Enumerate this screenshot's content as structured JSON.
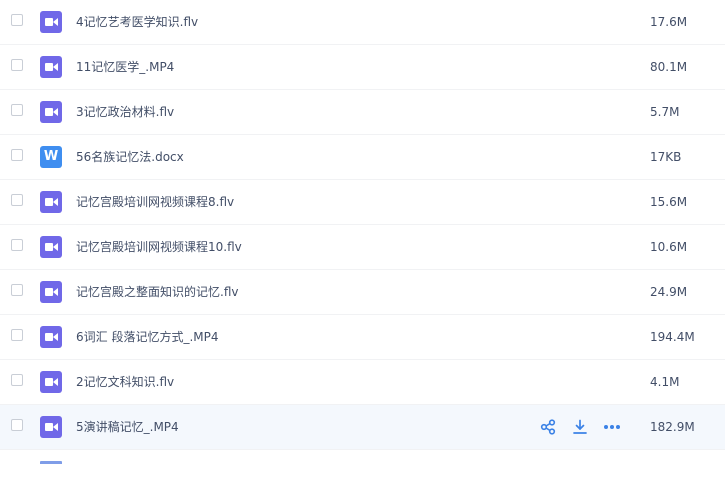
{
  "files": [
    {
      "name": "4记忆艺考医学知识.flv",
      "size": "17.6M",
      "type": "video",
      "icon": "video-file-icon"
    },
    {
      "name": "11记忆医学_.MP4",
      "size": "80.1M",
      "type": "video",
      "icon": "video-file-icon"
    },
    {
      "name": "3记忆政治材料.flv",
      "size": "5.7M",
      "type": "video",
      "icon": "video-file-icon"
    },
    {
      "name": "56名族记忆法.docx",
      "size": "17KB",
      "type": "word",
      "icon": "word-file-icon",
      "icon_letter": "W"
    },
    {
      "name": "记忆宫殿培训网视频课程8.flv",
      "size": "15.6M",
      "type": "video",
      "icon": "video-file-icon"
    },
    {
      "name": "记忆宫殿培训网视频课程10.flv",
      "size": "10.6M",
      "type": "video",
      "icon": "video-file-icon"
    },
    {
      "name": "记忆宫殿之整面知识的记忆.flv",
      "size": "24.9M",
      "type": "video",
      "icon": "video-file-icon"
    },
    {
      "name": "6词汇 段落记忆方式_.MP4",
      "size": "194.4M",
      "type": "video",
      "icon": "video-file-icon"
    },
    {
      "name": "2记忆文科知识.flv",
      "size": "4.1M",
      "type": "video",
      "icon": "video-file-icon"
    },
    {
      "name": "5演讲稿记忆_.MP4",
      "size": "182.9M",
      "type": "video",
      "icon": "video-file-icon",
      "hovered": true
    }
  ],
  "row_actions": {
    "icons": [
      "share-icon",
      "download-icon",
      "more-icon"
    ]
  },
  "colors": {
    "video_icon": "#7068e8",
    "word_icon": "#3f8ef0",
    "action_icon": "#3b82e6",
    "hover_row": "#f4f8fd",
    "text": "#424e67"
  }
}
